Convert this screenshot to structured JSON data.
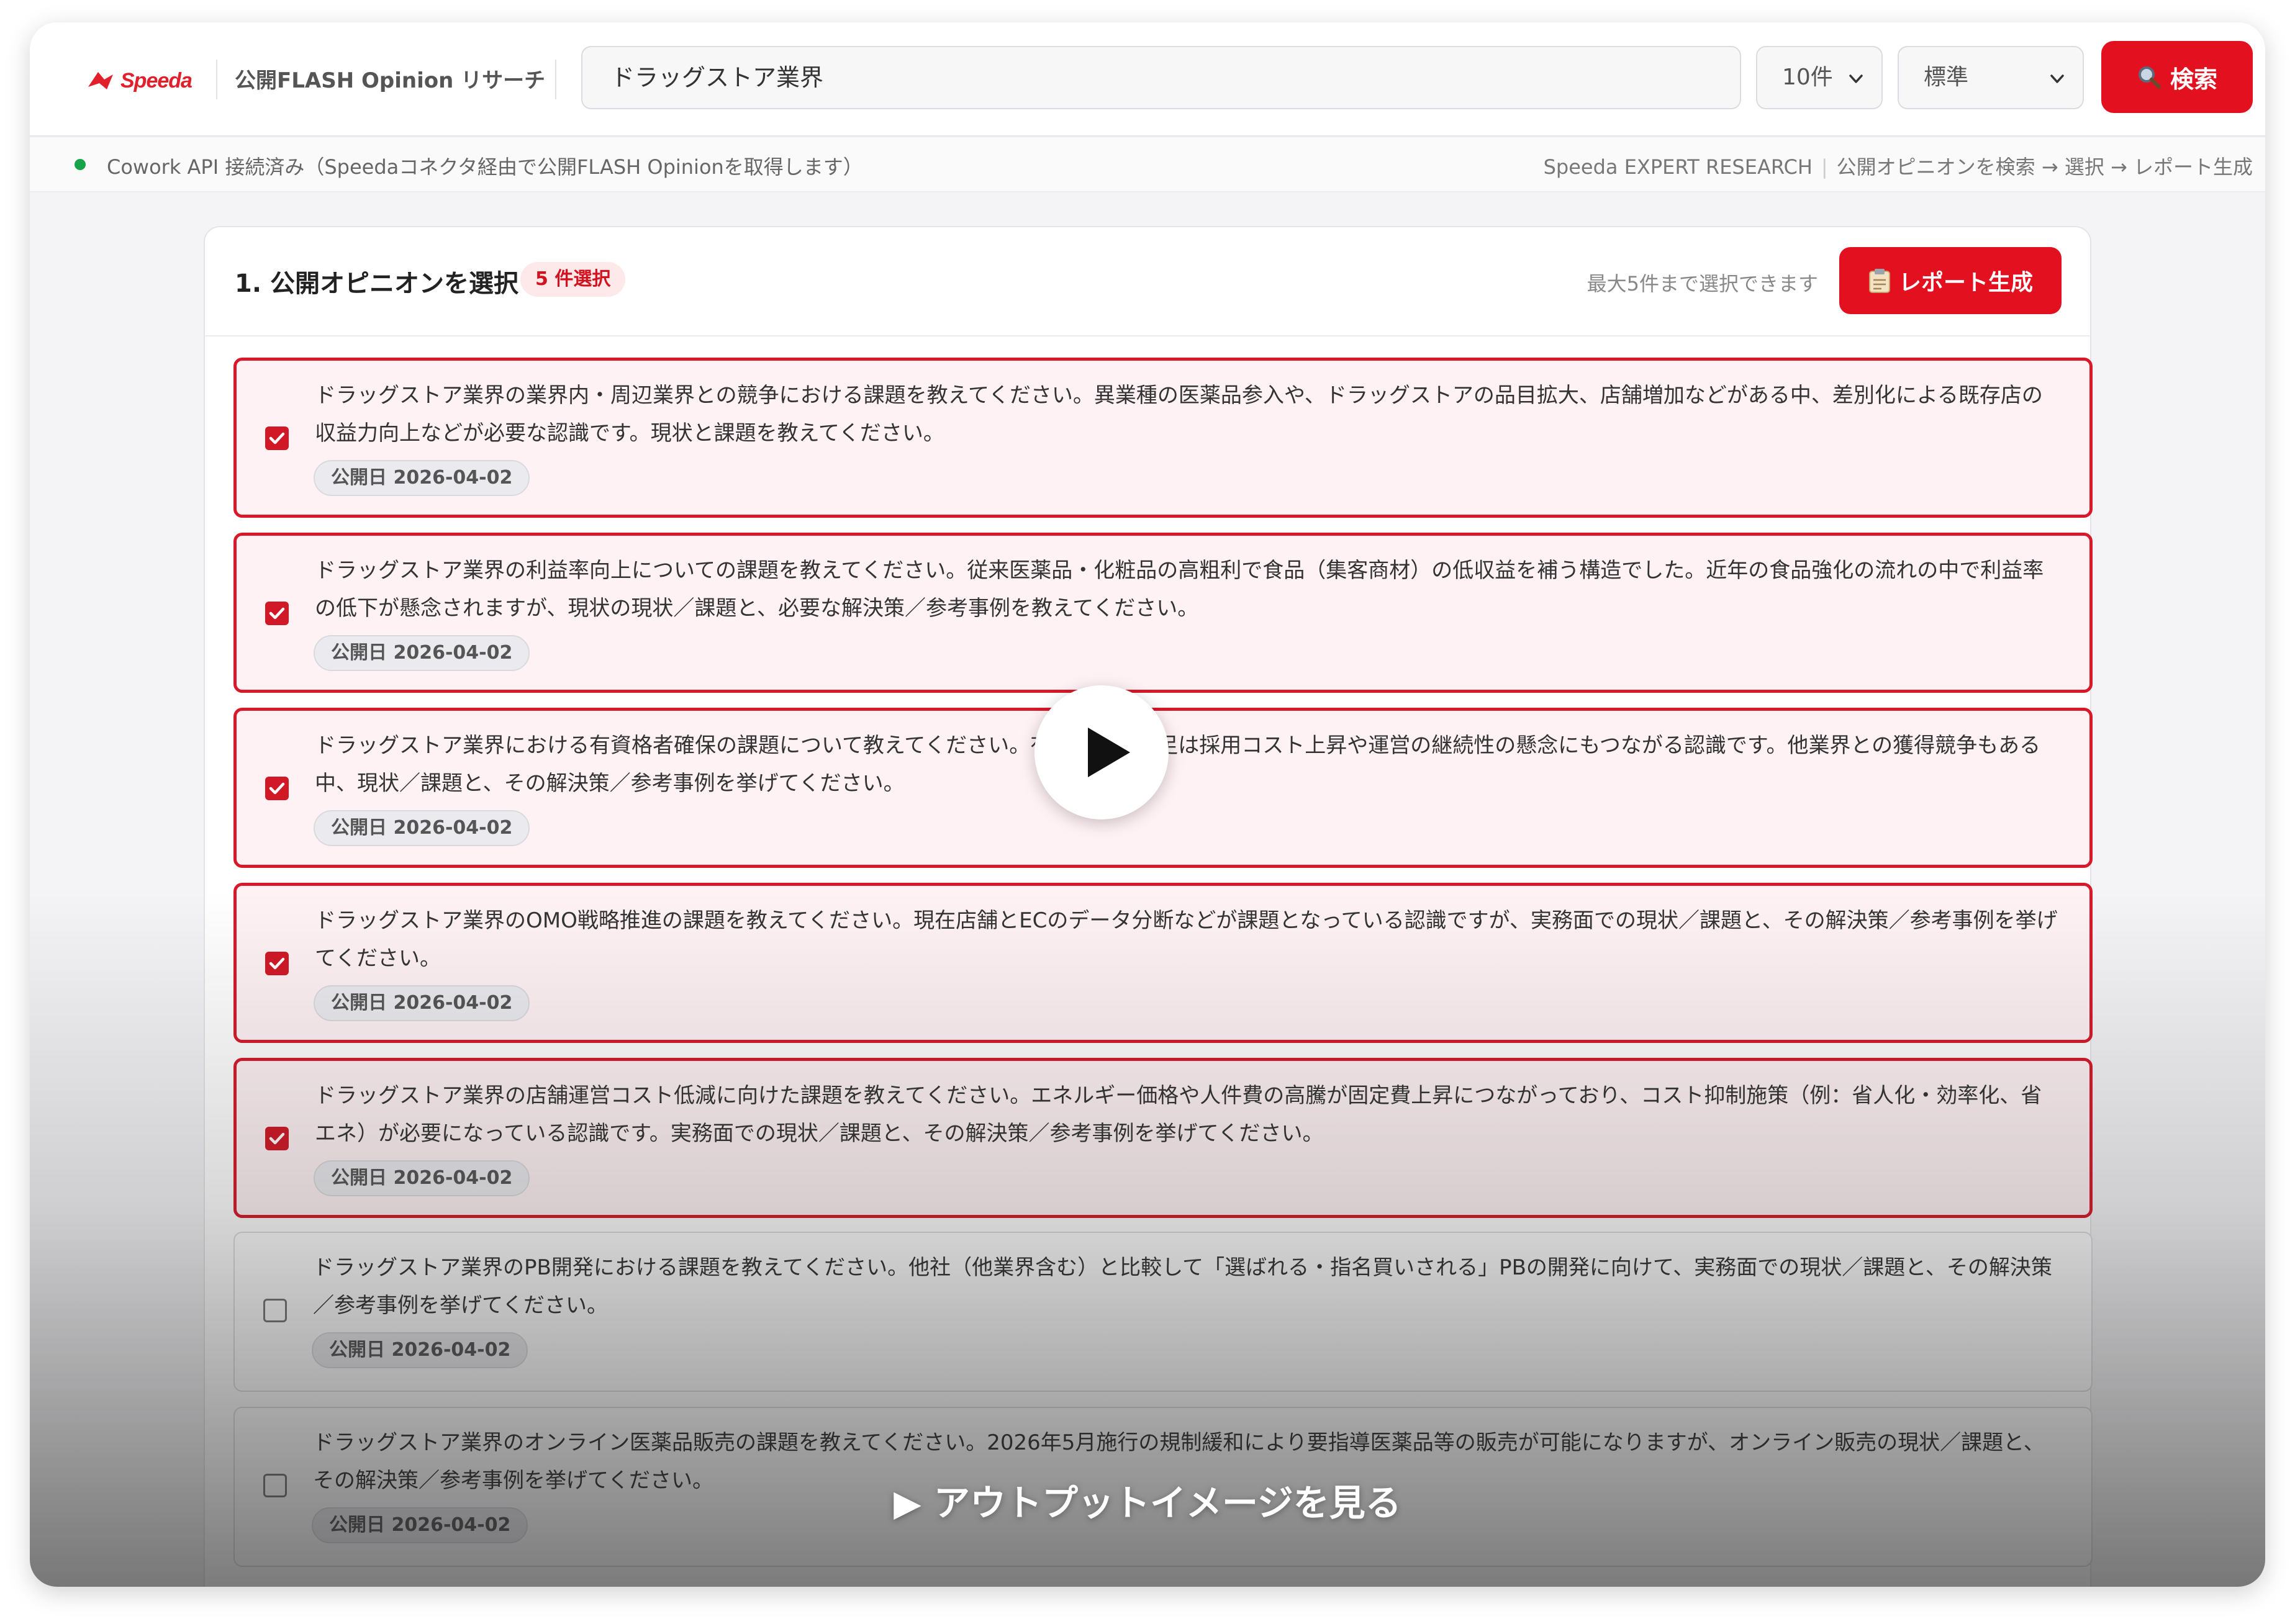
{
  "header": {
    "logo_text": "Speeda",
    "app_title": "公開FLASH Opinion リサーチ",
    "search_value": "ドラッグストア業界",
    "count_select": "10件",
    "mode_select": "標準",
    "search_button": "検索"
  },
  "status": {
    "text": "Cowork API 接続済み（Speedaコネクタ経由で公開FLASH Opinionを取得します）",
    "steps_brand": "Speeda EXPERT RESEARCH",
    "steps_flow": "公開オピニオンを検索 → 選択 → レポート生成"
  },
  "panel": {
    "title": "1. 公開オピニオンを選択",
    "badge": "5 件選択",
    "hint": "最大5件まで選択できます",
    "report_button": "レポート生成"
  },
  "items": [
    {
      "text": "ドラッグストア業界の業界内・周辺業界との競争における課題を教えてください。異業種の医薬品参入や、ドラッグストアの品目拡大、店舗増加などがある中、差別化による既存店の収益力向上などが必要な認識です。現状と課題を教えてください。",
      "date": "公開日 2026-04-02",
      "checked": true
    },
    {
      "text": "ドラッグストア業界の利益率向上についての課題を教えてください。従来医薬品・化粧品の高粗利で食品（集客商材）の低収益を補う構造でした。近年の食品強化の流れの中で利益率の低下が懸念されますが、現状の現状／課題と、必要な解決策／参考事例を教えてください。",
      "date": "公開日 2026-04-02",
      "checked": true
    },
    {
      "text": "ドラッグストア業界における有資格者確保の課題について教えてください。有資格者の不足は採用コスト上昇や運営の継続性の懸念にもつながる認識です。他業界との獲得競争もある中、現状／課題と、その解決策／参考事例を挙げてください。",
      "date": "公開日 2026-04-02",
      "checked": true
    },
    {
      "text": "ドラッグストア業界のOMO戦略推進の課題を教えてください。現在店舗とECのデータ分断などが課題となっている認識ですが、実務面での現状／課題と、その解決策／参考事例を挙げてください。",
      "date": "公開日 2026-04-02",
      "checked": true
    },
    {
      "text": "ドラッグストア業界の店舗運営コスト低減に向けた課題を教えてください。エネルギー価格や人件費の高騰が固定費上昇につながっており、コスト抑制施策（例：省人化・効率化、省エネ）が必要になっている認識です。実務面での現状／課題と、その解決策／参考事例を挙げてください。",
      "date": "公開日 2026-04-02",
      "checked": true
    },
    {
      "text": "ドラッグストア業界のPB開発における課題を教えてください。他社（他業界含む）と比較して「選ばれる・指名買いされる」PBの開発に向けて、実務面での現状／課題と、その解決策／参考事例を挙げてください。",
      "date": "公開日 2026-04-02",
      "checked": false
    },
    {
      "text": "ドラッグストア業界のオンライン医薬品販売の課題を教えてください。2026年5月施行の規制緩和により要指導医薬品等の販売が可能になりますが、オンライン販売の現状／課題と、その解決策／参考事例を挙げてください。",
      "date": "公開日 2026-04-02",
      "checked": false
    }
  ],
  "overlay": {
    "output_link": "▶ アウトプットイメージを見る"
  },
  "colors": {
    "accent": "#e3101f",
    "selected_bg": "#fff2f4",
    "status_ok": "#16a34a"
  }
}
